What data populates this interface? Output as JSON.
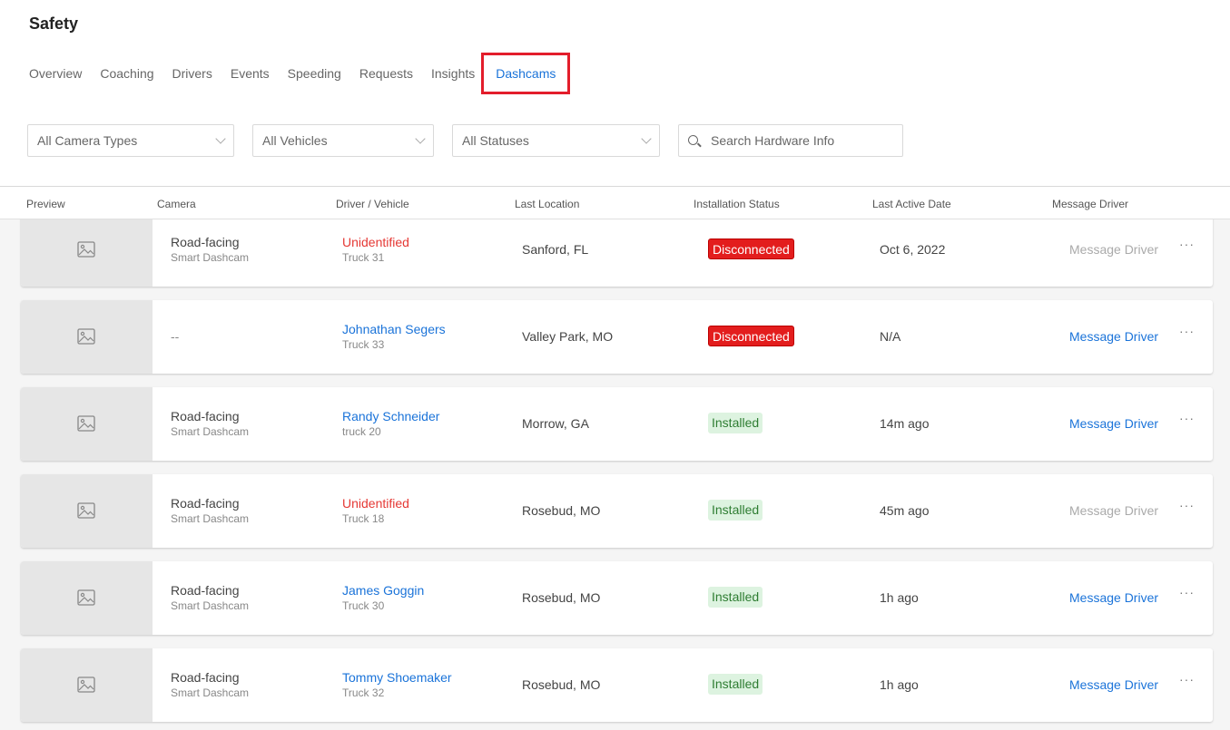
{
  "page": {
    "title": "Safety"
  },
  "tabs": [
    {
      "label": "Overview"
    },
    {
      "label": "Coaching"
    },
    {
      "label": "Drivers"
    },
    {
      "label": "Events"
    },
    {
      "label": "Speeding"
    },
    {
      "label": "Requests"
    },
    {
      "label": "Insights"
    },
    {
      "label": "Dashcams",
      "active": true
    }
  ],
  "filters": {
    "camera_type": "All Camera Types",
    "vehicles": "All Vehicles",
    "statuses": "All Statuses",
    "search_placeholder": "Search Hardware Info"
  },
  "columns": {
    "preview": "Preview",
    "camera": "Camera",
    "driver_vehicle": "Driver / Vehicle",
    "last_location": "Last Location",
    "installation_status": "Installation Status",
    "last_active": "Last Active Date",
    "message_driver": "Message Driver"
  },
  "rows": [
    {
      "camera": "Road-facing",
      "camera_sub": "Smart Dashcam",
      "driver": "Unidentified",
      "vehicle": "Truck 31",
      "location": "Sanford, FL",
      "status": "Disconnected",
      "last_active": "Oct 6, 2022",
      "message": "Message Driver",
      "more": "···"
    },
    {
      "camera": "--",
      "camera_sub": "",
      "driver": "Johnathan Segers",
      "vehicle": "Truck 33",
      "location": "Valley Park, MO",
      "status": "Disconnected",
      "last_active": "N/A",
      "message": "Message Driver",
      "more": "···"
    },
    {
      "camera": "Road-facing",
      "camera_sub": "Smart Dashcam",
      "driver": "Randy Schneider",
      "vehicle": "truck 20",
      "location": "Morrow, GA",
      "status": "Installed",
      "last_active": "14m ago",
      "message": "Message Driver",
      "more": "···"
    },
    {
      "camera": "Road-facing",
      "camera_sub": "Smart Dashcam",
      "driver": "Unidentified",
      "vehicle": "Truck 18",
      "location": "Rosebud, MO",
      "status": "Installed",
      "last_active": "45m ago",
      "message": "Message Driver",
      "more": "···"
    },
    {
      "camera": "Road-facing",
      "camera_sub": "Smart Dashcam",
      "driver": "James Goggin",
      "vehicle": "Truck 30",
      "location": "Rosebud, MO",
      "status": "Installed",
      "last_active": "1h ago",
      "message": "Message Driver",
      "more": "···"
    },
    {
      "camera": "Road-facing",
      "camera_sub": "Smart Dashcam",
      "driver": "Tommy Shoemaker",
      "vehicle": "Truck 32",
      "location": "Rosebud, MO",
      "status": "Installed",
      "last_active": "1h ago",
      "message": "Message Driver",
      "more": "···"
    }
  ],
  "colors": {
    "accent": "#1a73d9",
    "highlight_box": "#e31d2b",
    "disconnected": "#e31d1d",
    "installed_bg": "#ddf3e0",
    "installed_text": "#2e7d32",
    "unidentified": "#e53935"
  },
  "icons": {
    "preview": "image-placeholder-icon",
    "search": "search-icon",
    "dropdown": "chevron-down-icon",
    "more": "more-options-icon"
  }
}
